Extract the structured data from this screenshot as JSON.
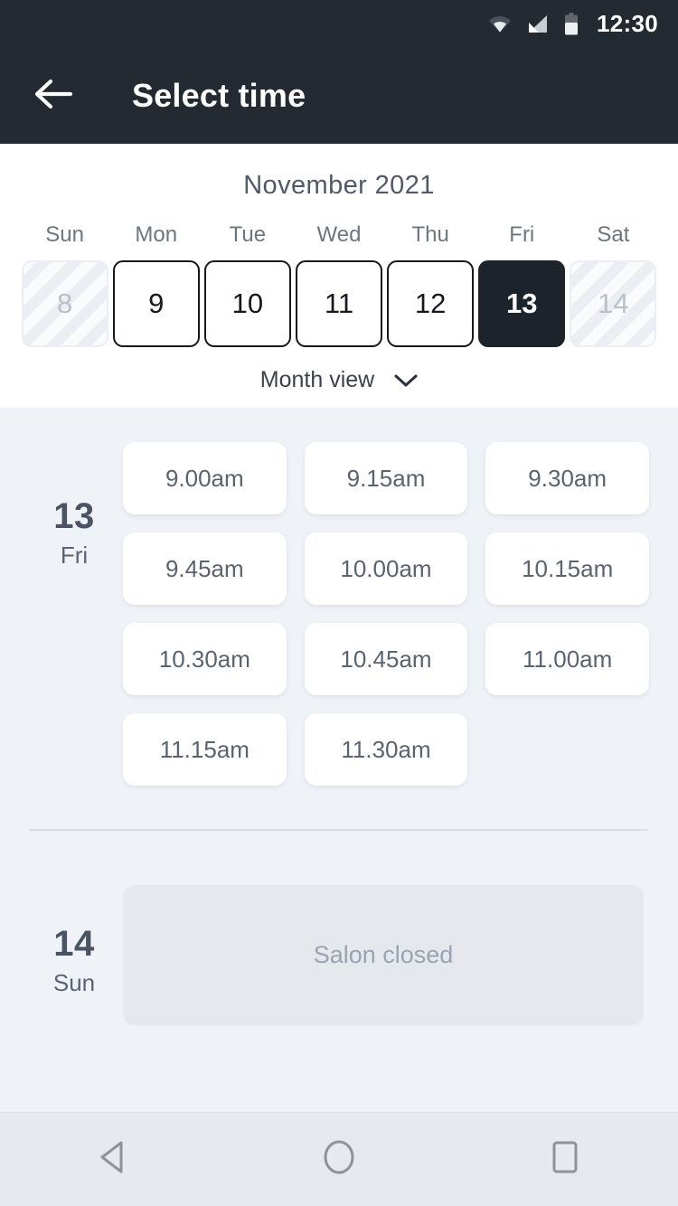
{
  "status_bar": {
    "time": "12:30",
    "icons": [
      "wifi-icon",
      "signal-icon",
      "battery-icon"
    ]
  },
  "app_bar": {
    "back_icon": "back-arrow-icon",
    "title": "Select time"
  },
  "calendar": {
    "month_title": "November 2021",
    "day_of_week_labels": [
      "Sun",
      "Mon",
      "Tue",
      "Wed",
      "Thu",
      "Fri",
      "Sat"
    ],
    "days": [
      {
        "number": "8",
        "state": "disabled"
      },
      {
        "number": "9",
        "state": "enabled"
      },
      {
        "number": "10",
        "state": "enabled"
      },
      {
        "number": "11",
        "state": "enabled"
      },
      {
        "number": "12",
        "state": "enabled"
      },
      {
        "number": "13",
        "state": "selected"
      },
      {
        "number": "14",
        "state": "disabled"
      }
    ],
    "view_toggle": {
      "label": "Month view",
      "icon": "chevron-down-icon"
    }
  },
  "schedule": [
    {
      "day_number": "13",
      "day_name": "Fri",
      "slots": [
        "9.00am",
        "9.15am",
        "9.30am",
        "9.45am",
        "10.00am",
        "10.15am",
        "10.30am",
        "10.45am",
        "11.00am",
        "11.15am",
        "11.30am"
      ]
    },
    {
      "day_number": "14",
      "day_name": "Sun",
      "closed_message": "Salon closed"
    }
  ],
  "nav_bar": {
    "back": "back-triangle-icon",
    "home": "home-circle-icon",
    "recents": "recents-square-icon"
  },
  "colors": {
    "header_bg": "#242A31",
    "page_bg": "#EFF2F7",
    "panel_bg": "#FFFFFF",
    "selected_day": "#1D232B",
    "muted_text": "#6D7583",
    "slot_text": "#5A6372",
    "closed_panel": "#E5E9EE",
    "nav_bg": "#E6E9EE"
  }
}
